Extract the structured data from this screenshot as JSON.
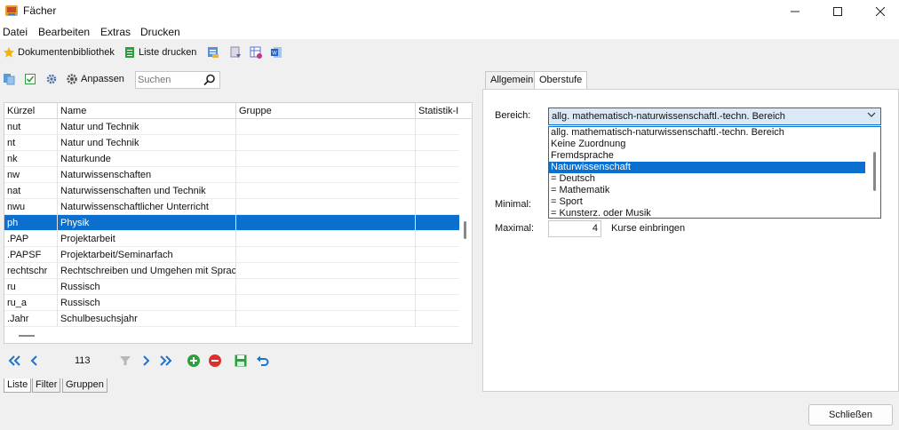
{
  "window": {
    "title": "Fächer"
  },
  "menu": [
    "Datei",
    "Bearbeiten",
    "Extras",
    "Drucken"
  ],
  "toolbar": {
    "library_label": "Dokumentenbibliothek",
    "print_list_label": "Liste drucken"
  },
  "list_toolbar": {
    "customize_label": "Anpassen",
    "search_placeholder": "Suchen"
  },
  "grid": {
    "columns": [
      "Kürzel",
      "Name",
      "Gruppe",
      "Statistik-I"
    ],
    "rows": [
      [
        "nut",
        "Natur und Technik",
        "",
        ""
      ],
      [
        "nt",
        "Natur und Technik",
        "",
        ""
      ],
      [
        "nk",
        "Naturkunde",
        "",
        ""
      ],
      [
        "nw",
        "Naturwissenschaften",
        "",
        ""
      ],
      [
        "nat",
        "Naturwissenschaften und Technik",
        "",
        ""
      ],
      [
        "nwu",
        "Naturwissenschaftlicher Unterricht",
        "",
        ""
      ],
      [
        "ph",
        "Physik",
        "",
        ""
      ],
      [
        ".PAP",
        "Projektarbeit",
        "",
        ""
      ],
      [
        ".PAPSF",
        "Projektarbeit/Seminarfach",
        "",
        ""
      ],
      [
        "rechtschr",
        "Rechtschreiben und Umgehen mit Sprache",
        "",
        ""
      ],
      [
        "ru",
        "Russisch",
        "",
        ""
      ],
      [
        "ru_a",
        "Russisch",
        "",
        ""
      ],
      [
        ".Jahr",
        "Schulbesuchsjahr",
        "",
        ""
      ]
    ],
    "selected_row": 6
  },
  "navigation": {
    "record_count": "113"
  },
  "bottom_tabs": [
    "Liste",
    "Filter",
    "Gruppen"
  ],
  "right_tabs": [
    "Allgemein",
    "Oberstufe"
  ],
  "oberstufe": {
    "bereich_label": "Bereich:",
    "bereich_value": "allg. mathematisch-naturwissenschaftl.-techn. Bereich",
    "dropdown_options": [
      "allg. mathematisch-naturwissenschaftl.-techn. Bereich",
      "Keine Zuordnung",
      "Fremdsprache",
      "Naturwissenschaft",
      "= Deutsch",
      "= Mathematik",
      "= Sport",
      "= Kunsterz. oder Musik"
    ],
    "dropdown_selected": 3,
    "minimal_label": "Minimal:",
    "maximal_label": "Maximal:",
    "maximal_value": "4",
    "kurse_label": "Kurse einbringen"
  },
  "footer": {
    "close_label": "Schließen"
  },
  "colors": {
    "accent": "#0b6fd0",
    "nav_blue": "#1e73c8",
    "add_green": "#2e9e3e",
    "remove_red": "#d9302c"
  }
}
